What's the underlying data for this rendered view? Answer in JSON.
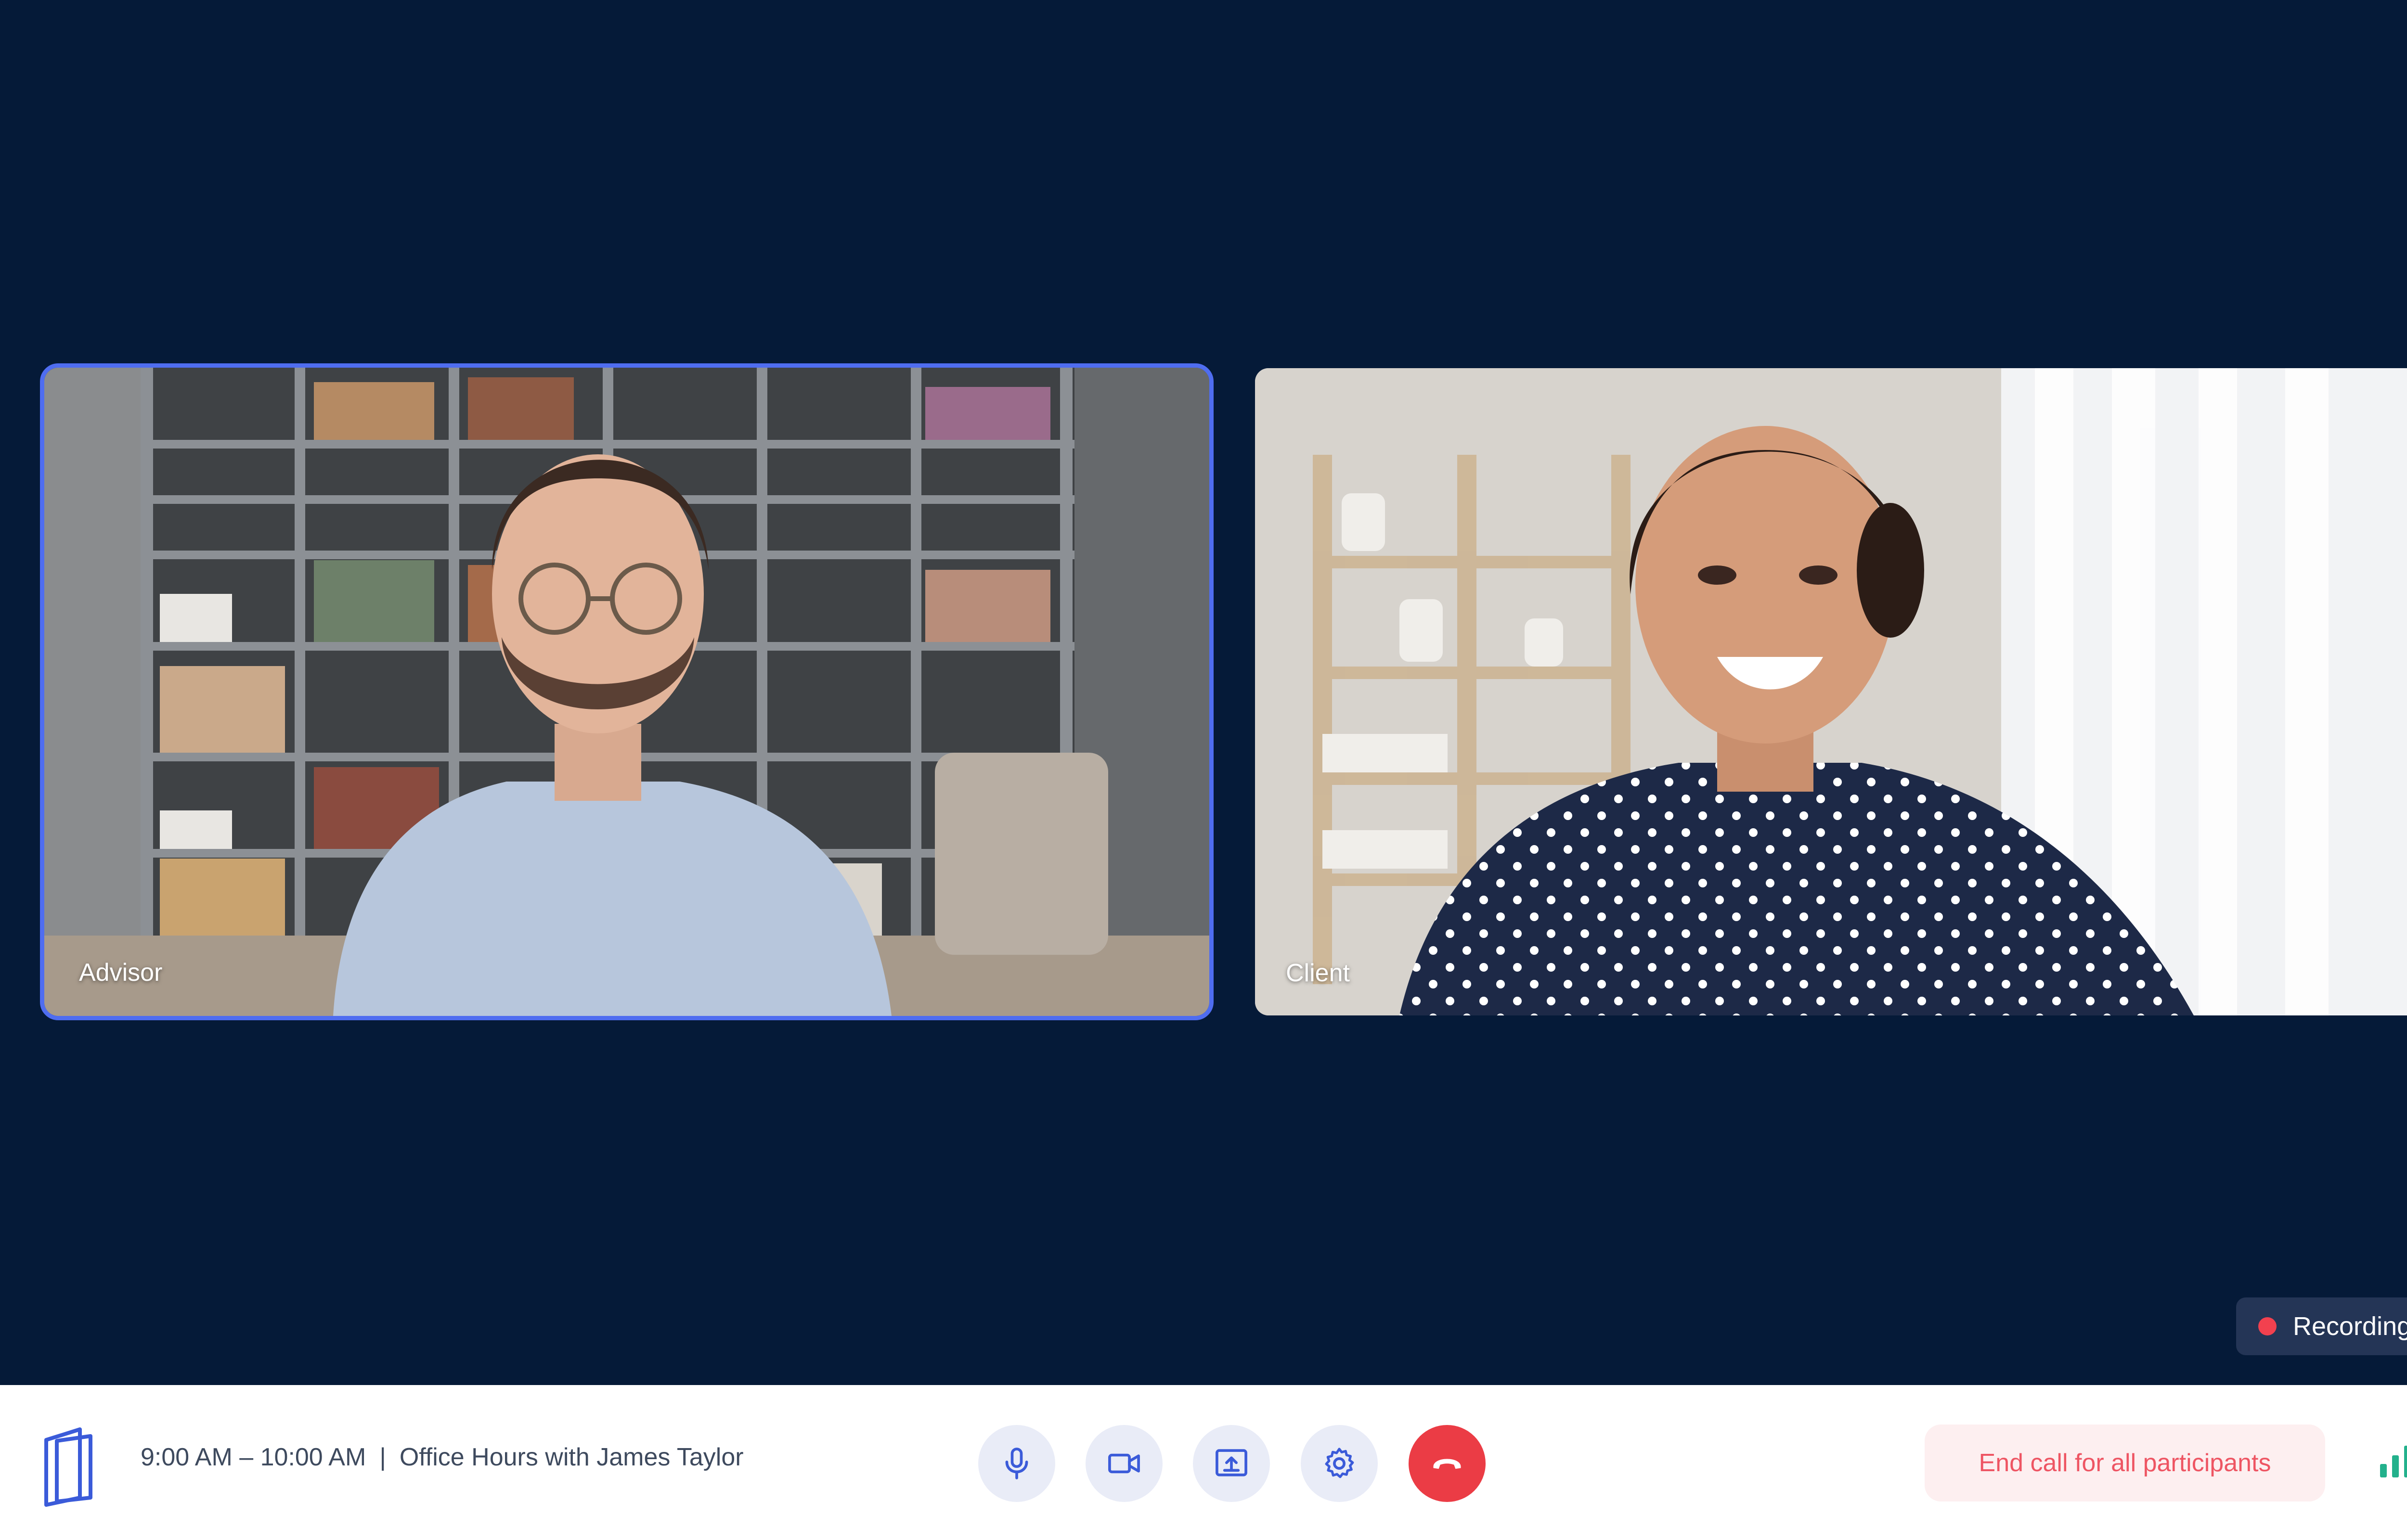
{
  "stage": {
    "background": "#051a38"
  },
  "participants": [
    {
      "label": "Advisor",
      "active": true,
      "active_border_color": "#4f6df0"
    },
    {
      "label": "Client",
      "active": false
    }
  ],
  "recording": {
    "label": "Recording",
    "dot_color": "#f2414f"
  },
  "toolbar": {
    "logo_icon": "app-logo-icon",
    "time_range": "9:00 AM – 10:00 AM",
    "separator": "|",
    "meeting_title": "Office Hours with James Taylor",
    "controls": [
      {
        "name": "microphone-button",
        "icon": "microphone-icon"
      },
      {
        "name": "camera-button",
        "icon": "video-camera-icon"
      },
      {
        "name": "share-screen-button",
        "icon": "share-screen-icon"
      },
      {
        "name": "settings-button",
        "icon": "gear-icon"
      },
      {
        "name": "hang-up-button",
        "icon": "phone-hangup-icon",
        "color": "#eb3c45"
      }
    ],
    "end_call_all_label": "End call for all participants",
    "end_call_color": "#ee5563",
    "signal_icon": "signal-strength-icon",
    "signal_color": "#23b18c"
  }
}
